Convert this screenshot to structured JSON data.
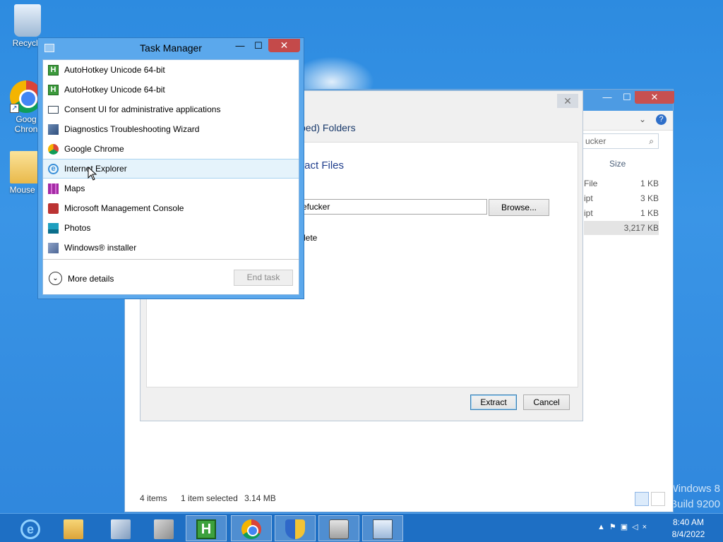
{
  "desktop": {
    "icons": [
      {
        "label": "Recycle",
        "icon": "recycle-bin-icon"
      },
      {
        "label": "Goog Chron",
        "icon": "chrome-icon"
      },
      {
        "label": "Mouse F",
        "icon": "folder-icon"
      }
    ],
    "watermark_line1": "Windows 8",
    "watermark_line2": "Build 9200"
  },
  "explorer": {
    "search_placeholder": "ucker",
    "size_header": "Size",
    "rows": [
      {
        "name_fragment": "File",
        "size": "1 KB",
        "selected": false
      },
      {
        "name_fragment": "ipt",
        "size": "3 KB",
        "selected": false
      },
      {
        "name_fragment": "ipt",
        "size": "1 KB",
        "selected": false
      },
      {
        "name_fragment": "",
        "size": "3,217 KB",
        "selected": true
      }
    ],
    "status_items": "4 items",
    "status_selected": "1 item selected",
    "status_size": "3.14 MB",
    "controls": {
      "minimize": "—",
      "maximize": "☐",
      "close": "✕"
    }
  },
  "wizard": {
    "title_fragment": "ped) Folders",
    "heading_fragment": "tract Files",
    "destination_value": "efucker",
    "browse_label": "Browse...",
    "checkbox_label_fragment": "lete",
    "extract_label": "Extract",
    "cancel_label": "Cancel",
    "close_glyph": "✕"
  },
  "task_manager": {
    "title": "Task Manager",
    "controls": {
      "minimize": "—",
      "maximize": "☐",
      "close": "✕"
    },
    "apps": [
      {
        "name": "AutoHotkey Unicode 64-bit",
        "icon": "autohotkey-icon"
      },
      {
        "name": "AutoHotkey Unicode 64-bit",
        "icon": "autohotkey-icon"
      },
      {
        "name": "Consent UI for administrative applications",
        "icon": "window-icon"
      },
      {
        "name": "Diagnostics Troubleshooting Wizard",
        "icon": "diagnostics-icon"
      },
      {
        "name": "Google Chrome",
        "icon": "chrome-icon"
      },
      {
        "name": "Internet Explorer",
        "icon": "internet-explorer-icon"
      },
      {
        "name": "Maps",
        "icon": "maps-icon"
      },
      {
        "name": "Microsoft Management Console",
        "icon": "mmc-icon"
      },
      {
        "name": "Photos",
        "icon": "photos-icon"
      },
      {
        "name": "Windows® installer",
        "icon": "installer-icon"
      }
    ],
    "hovered_index": 5,
    "more_details_label": "More details",
    "end_task_label": "End task"
  },
  "taskbar": {
    "buttons": [
      {
        "name": "internet-explorer",
        "icon": "internet-explorer-icon",
        "active": false
      },
      {
        "name": "file-explorer",
        "icon": "folder-icon",
        "active": false
      },
      {
        "name": "network",
        "icon": "network-icon",
        "active": false
      },
      {
        "name": "cabinet",
        "icon": "cabinet-icon",
        "active": false
      },
      {
        "name": "autohotkey",
        "icon": "autohotkey-icon",
        "active": true
      },
      {
        "name": "chrome",
        "icon": "chrome-icon",
        "active": true
      },
      {
        "name": "uac",
        "icon": "shield-icon",
        "active": true
      },
      {
        "name": "drive",
        "icon": "drive-icon",
        "active": true
      },
      {
        "name": "task-manager",
        "icon": "task-manager-icon",
        "active": true
      }
    ],
    "tray_icons": [
      "chevron-up-icon",
      "flag-icon",
      "network-icon",
      "volume-muted-icon"
    ],
    "clock_time": "8:40 AM",
    "clock_date": "8/4/2022"
  },
  "colors": {
    "desktop": "#2d8be0",
    "taskbar": "#1e6fc4",
    "close_button": "#c44a4a",
    "hover_row": "#e5f3fb",
    "accent": "#3c9a3c"
  }
}
